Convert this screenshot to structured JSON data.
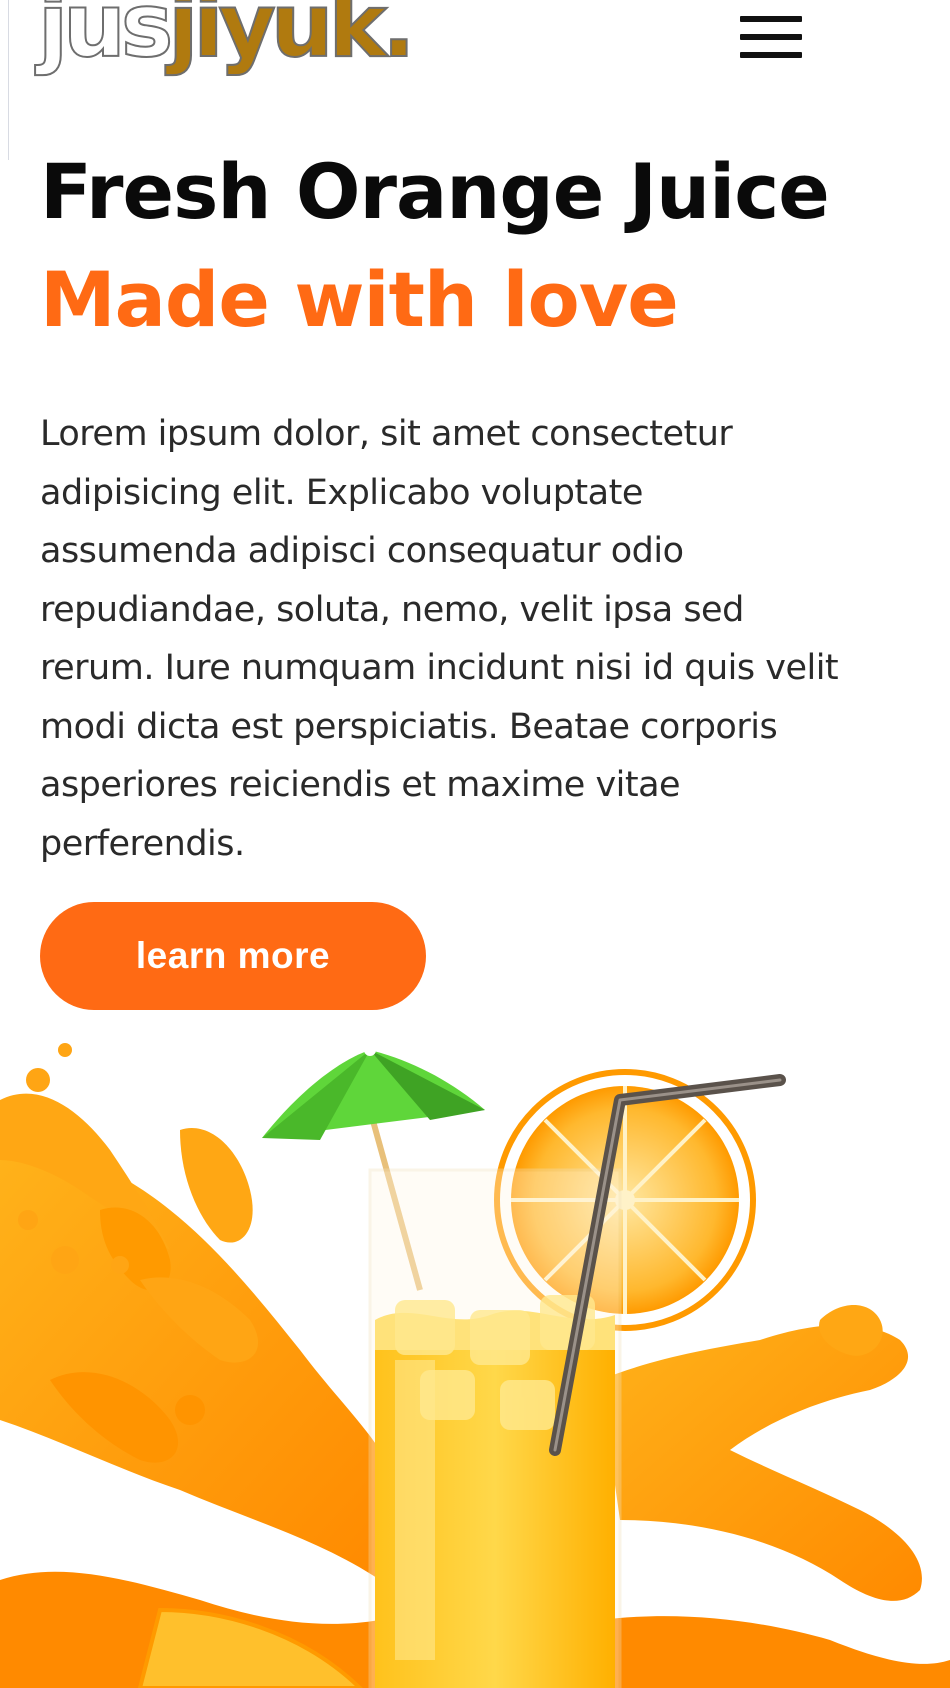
{
  "header": {
    "logo_part1": "jus",
    "logo_part2": "jiyuk",
    "logo_dot": "."
  },
  "hero": {
    "title": "Fresh Orange Juice",
    "subtitle": "Made with love",
    "paragraph": "Lorem ipsum dolor, sit amet consectetur adipisicing elit. Explicabo voluptate assumenda adipisci consequatur odio repudiandae, soluta, nemo, velit ipsa sed rerum. Iure numquam incidunt nisi id quis velit modi dicta est perspiciatis. Beatae corporis asperiores reiciendis et maxime vitae perferendis.",
    "cta_label": "learn more"
  },
  "colors": {
    "accent": "#ff6a14",
    "logo_gold": "#b07a0f",
    "text_dark": "#0a0a0a"
  },
  "icons": {
    "menu": "hamburger-menu-icon"
  }
}
